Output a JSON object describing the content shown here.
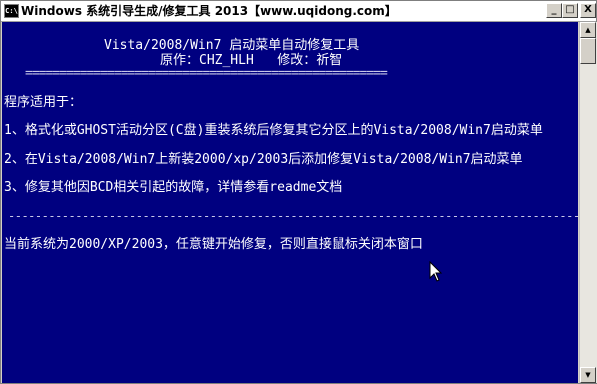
{
  "window": {
    "title": "Windows 系统引导生成/修复工具 2013【www.uqidong.com】",
    "icon_label": "C:\\",
    "controls": {
      "minimize": "_",
      "maximize": "□",
      "close": "X"
    }
  },
  "console": {
    "header_title": "Vista/2008/Win7 启动菜单自动修复工具",
    "author_line": "原作：CHZ_HLH   修改：祈智",
    "separator_top": "=====================================================",
    "applies_label": "程序适用于：",
    "items": [
      "1、格式化或GHOST活动分区(C盘)重装系统后修复其它分区上的Vista/2008/Win7启动菜单",
      "2、在Vista/2008/Win7上新装2000/xp/2003后添加修复Vista/2008/Win7启动菜单",
      "3、修复其他因BCD相关引起的故障，详情参看readme文档"
    ],
    "separator_bottom": "--------------------------------------------------------------------------------------",
    "status_line": "当前系统为2000/XP/2003，任意键开始修复，否则直接鼠标关闭本窗口"
  },
  "colors": {
    "console_background": "#000080",
    "console_text": "#ffffff",
    "titlebar_background": "#ffffff"
  },
  "icons": {
    "app": "console-app-icon",
    "cursor": "mouse-pointer-icon",
    "scroll_up": "scroll-up-arrow-icon",
    "scroll_down": "scroll-down-arrow-icon"
  }
}
